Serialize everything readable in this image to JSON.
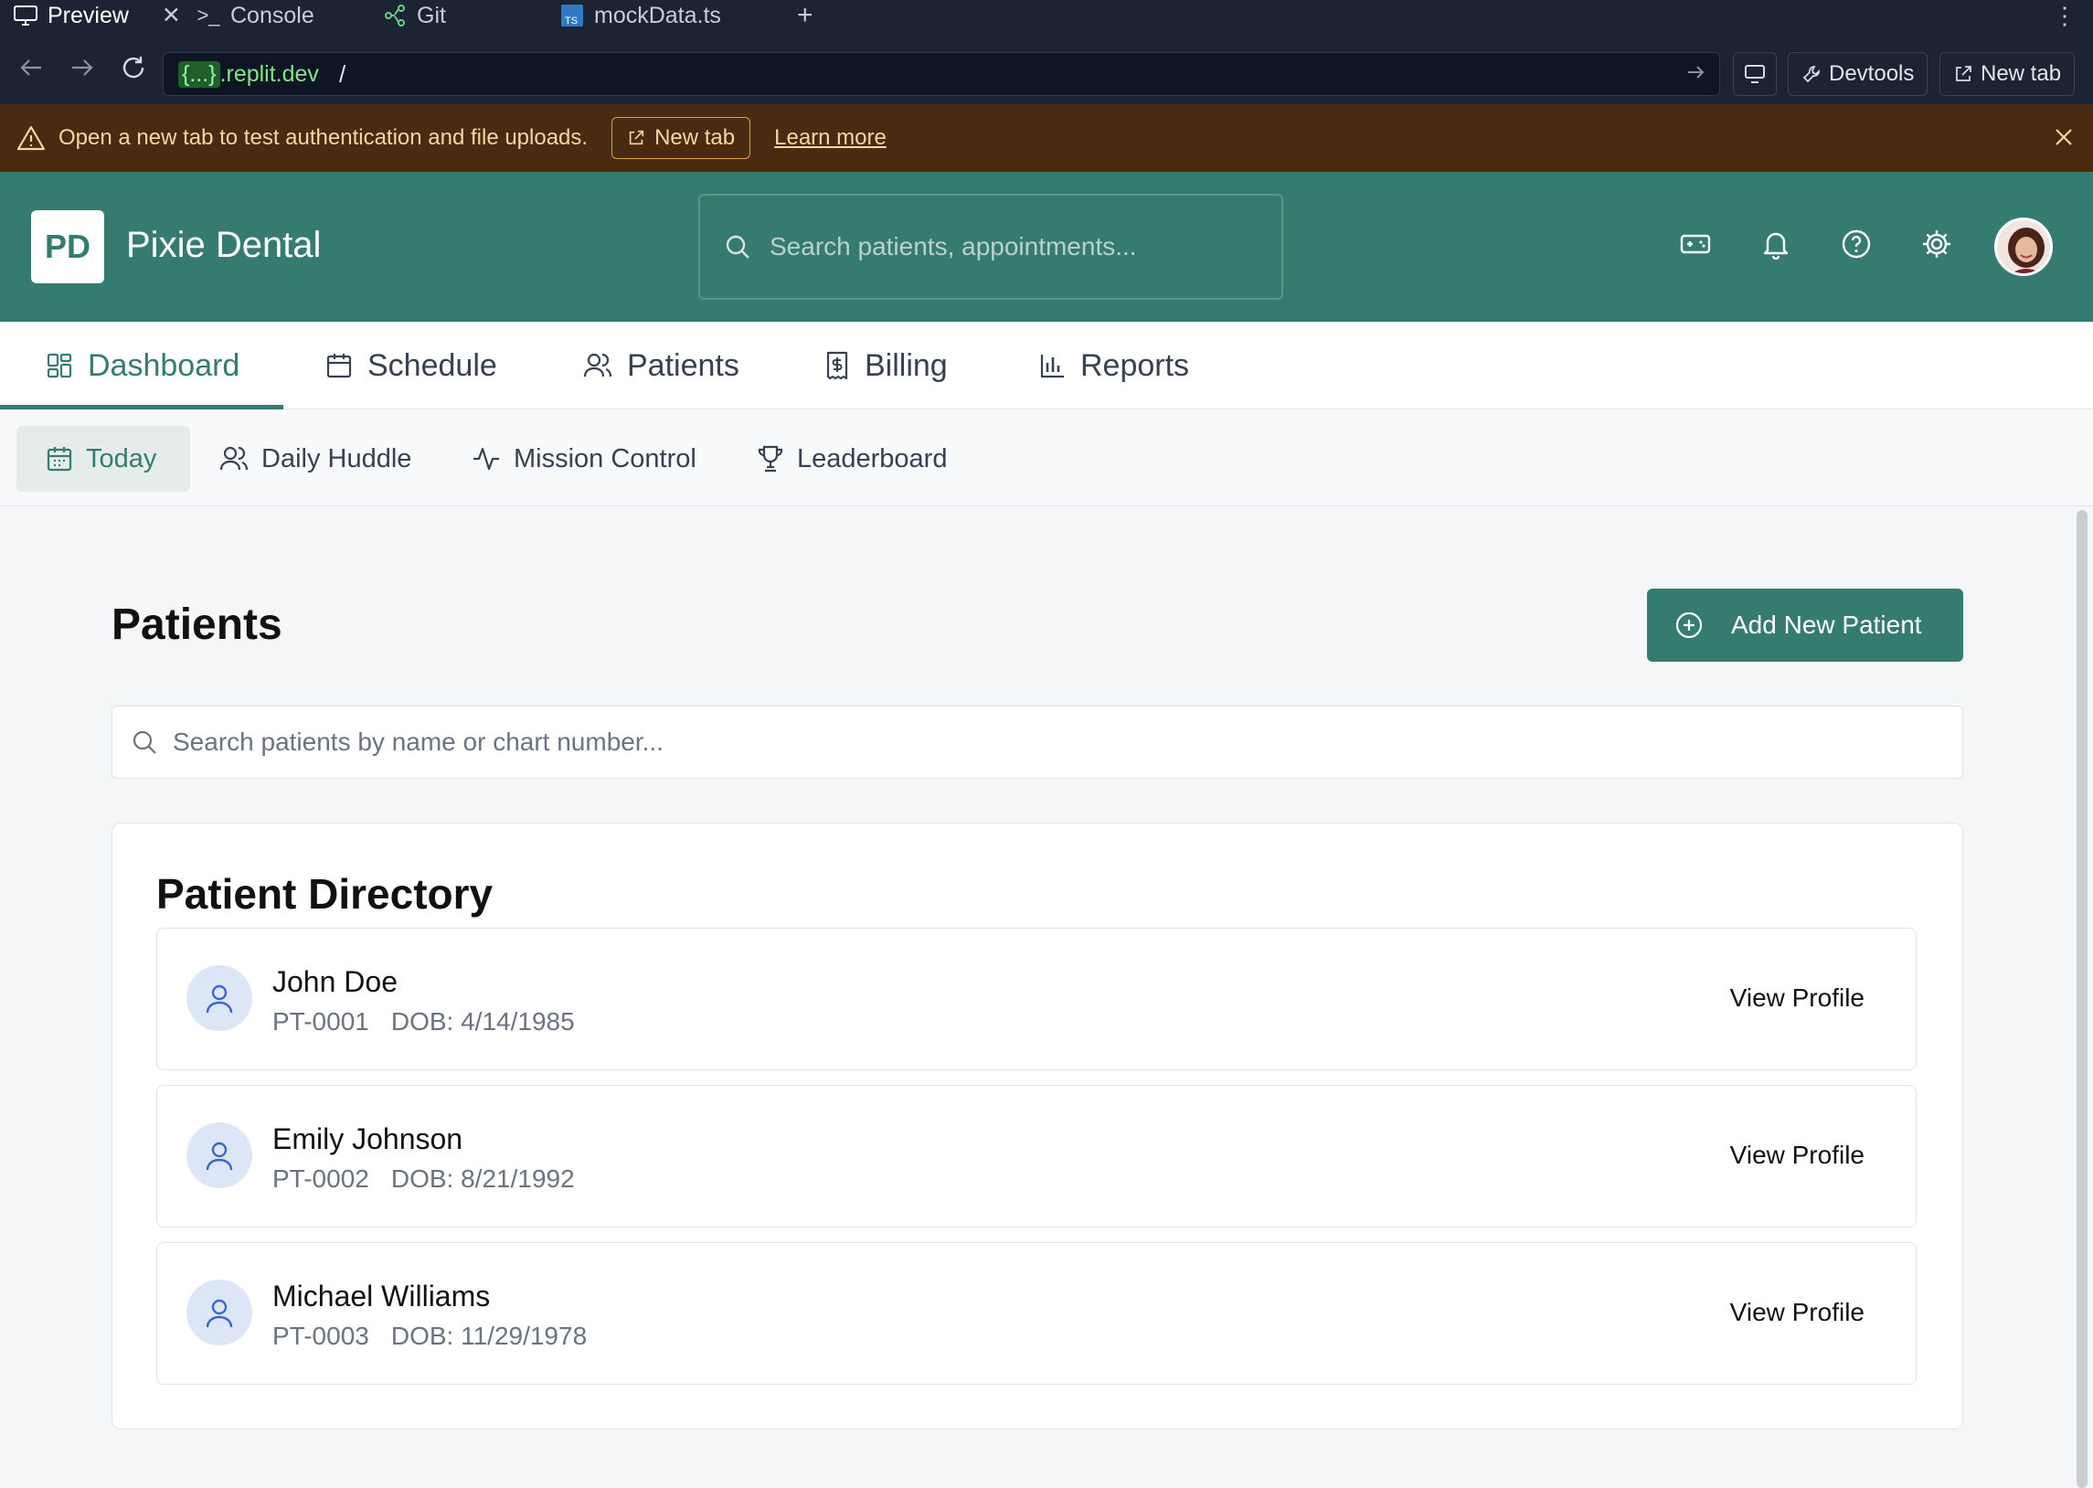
{
  "browser": {
    "tabs": [
      {
        "label": "Preview",
        "icon": "monitor-icon"
      },
      {
        "label": "Console",
        "icon": "terminal-icon"
      },
      {
        "label": "Git",
        "icon": "git-branch-icon"
      },
      {
        "label": "mockData.ts",
        "icon": "typescript-file-icon"
      }
    ],
    "url_host_prefix": "{...}",
    "url_host": ".replit.dev",
    "url_path": "/",
    "devtools_label": "Devtools",
    "new_tab_label": "New tab"
  },
  "banner": {
    "message": "Open a new tab to test authentication and file uploads.",
    "new_tab_label": "New tab",
    "learn_more_label": "Learn more",
    "bg_color": "#4a2a10"
  },
  "header": {
    "logo_text": "PD",
    "brand_name": "Pixie Dental",
    "search_placeholder": "Search patients, appointments...",
    "bg_color": "#367b6f"
  },
  "main_nav": {
    "tabs": [
      {
        "label": "Dashboard",
        "icon": "dashboard-icon"
      },
      {
        "label": "Schedule",
        "icon": "calendar-icon"
      },
      {
        "label": "Patients",
        "icon": "users-icon"
      },
      {
        "label": "Billing",
        "icon": "dollar-receipt-icon"
      },
      {
        "label": "Reports",
        "icon": "bar-chart-icon"
      }
    ],
    "active": "Dashboard"
  },
  "sub_nav": {
    "tabs": [
      {
        "label": "Today",
        "icon": "calendar-icon"
      },
      {
        "label": "Daily Huddle",
        "icon": "users-icon"
      },
      {
        "label": "Mission Control",
        "icon": "activity-icon"
      },
      {
        "label": "Leaderboard",
        "icon": "trophy-icon"
      }
    ],
    "active": "Today"
  },
  "page": {
    "title": "Patients",
    "add_button_label": "Add New Patient",
    "search_placeholder": "Search patients by name or chart number...",
    "directory_title": "Patient Directory",
    "view_profile_label": "View Profile"
  },
  "patients": [
    {
      "name": "John Doe",
      "chart": "PT-0001",
      "dob": "DOB: 4/14/1985"
    },
    {
      "name": "Emily Johnson",
      "chart": "PT-0002",
      "dob": "DOB: 8/21/1992"
    },
    {
      "name": "Michael Williams",
      "chart": "PT-0003",
      "dob": "DOB: 11/29/1978"
    }
  ]
}
